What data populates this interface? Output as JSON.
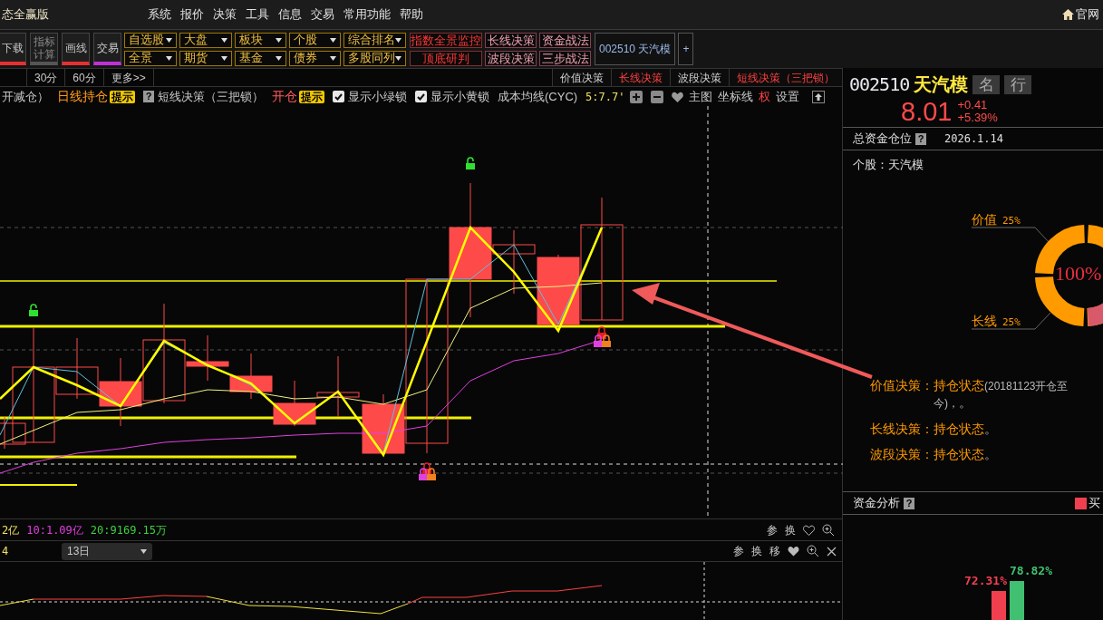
{
  "app_title": "态全赢版",
  "menu": [
    "系统",
    "报价",
    "决策",
    "工具",
    "信息",
    "交易",
    "常用功能",
    "帮助"
  ],
  "home_link": "官网",
  "tool_buttons": [
    {
      "label": "下载",
      "kind": "red"
    },
    {
      "label": "指标计算",
      "kind": "grey"
    },
    {
      "label": "画线",
      "kind": "red"
    },
    {
      "label": "交易",
      "kind": "purple"
    }
  ],
  "dropdown_rows": [
    [
      "自选股",
      "大盘",
      "板块",
      "个股",
      "综合排名"
    ],
    [
      "全景",
      "期货",
      "基金",
      "债券",
      "多股同列"
    ]
  ],
  "strategy_rows": [
    [
      {
        "label": "指数全景监控",
        "kind": "alert"
      },
      {
        "label": "长线决策",
        "kind": "normal"
      },
      {
        "label": "资金战法",
        "kind": "normal"
      }
    ],
    [
      {
        "label": "顶底研判",
        "kind": "alert"
      },
      {
        "label": "波段决策",
        "kind": "normal"
      },
      {
        "label": "三步战法",
        "kind": "normal"
      }
    ]
  ],
  "stock_tab": "002510 天汽模",
  "add_tab": "+",
  "periods": [
    "30分",
    "60分",
    "更多>>"
  ],
  "decision_tabs": [
    {
      "label": "价值决策",
      "kind": "normal"
    },
    {
      "label": "长线决策",
      "kind": "alert"
    },
    {
      "label": "波段决策",
      "kind": "normal"
    },
    {
      "label": "短线决策（三把锁）",
      "kind": "alert"
    }
  ],
  "legend": [
    {
      "kind": "text",
      "text": "开减仓）"
    },
    {
      "kind": "position",
      "text": "日线持仓"
    },
    {
      "kind": "badge",
      "text": "提示"
    },
    {
      "kind": "help",
      "text": "?"
    },
    {
      "kind": "text",
      "text": "短线决策（三把锁）"
    },
    {
      "kind": "signal",
      "text": "开仓"
    },
    {
      "kind": "badge",
      "text": "提示"
    },
    {
      "kind": "checkbox",
      "text": "显示小绿锁",
      "checked": true
    },
    {
      "kind": "checkbox",
      "text": "显示小黄锁",
      "checked": true
    },
    {
      "kind": "text",
      "text": "成本均线(CYC)"
    },
    {
      "kind": "value",
      "text": "5:7.7'"
    }
  ],
  "chart_tools": [
    {
      "text": "主图",
      "color": "#c8c8c8"
    },
    {
      "text": "坐标线",
      "color": "#c8c8c8"
    },
    {
      "text": "权",
      "color": "#ff4040"
    },
    {
      "text": "设置",
      "color": "#c8c8c8"
    }
  ],
  "volume_header": {
    "values": [
      {
        "text": "2亿",
        "color": "#f0e060"
      },
      {
        "text": "10:1.09亿",
        "color": "#e040e0"
      },
      {
        "text": "20:9169.15万",
        "color": "#40d040"
      }
    ],
    "tools": [
      "参",
      "换"
    ]
  },
  "indicator_header": {
    "value": "4",
    "period": "13日",
    "tools": [
      "参",
      "换",
      "移"
    ]
  },
  "quote": {
    "code": "002510",
    "name": "天汽模",
    "tags": [
      "名",
      "行"
    ],
    "price": "8.01",
    "change": "+0.41",
    "percent": "+5.39%"
  },
  "position": {
    "title": "总资金仓位",
    "help": "?",
    "date": "2026.1.14",
    "stock": "个股：天汽模",
    "center": "100%",
    "labels": [
      {
        "name": "价值",
        "percent": "25%"
      },
      {
        "name": "长线",
        "percent": "25%"
      }
    ]
  },
  "decisions": [
    {
      "label": "价值决策：",
      "status": "持仓状态",
      "note": "(20181123开仓至今)，",
      "end": "。"
    },
    {
      "label": "长线决策：",
      "status": "持仓状态",
      "end": "。"
    },
    {
      "label": "波段决策：",
      "status": "持仓状态",
      "end": "。"
    }
  ],
  "fund": {
    "title": "资金分析",
    "help": "?",
    "legend": "买",
    "bars": [
      {
        "label": "72.31%",
        "color": "#f04050"
      },
      {
        "label": "78.82%",
        "color": "#40c070"
      }
    ]
  }
}
